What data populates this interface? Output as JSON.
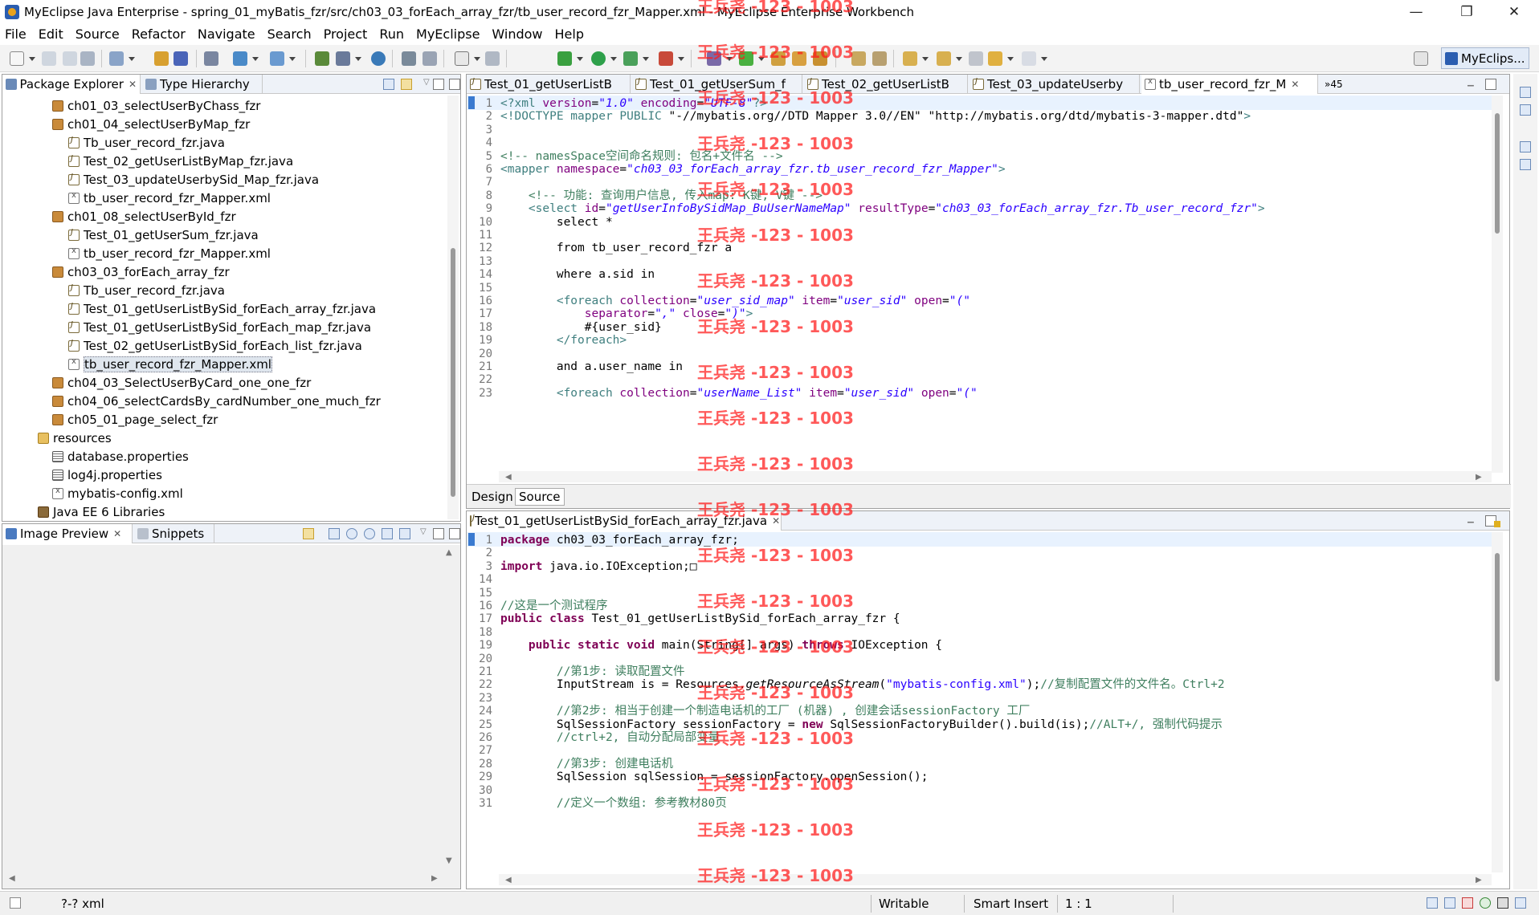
{
  "window": {
    "title": "MyEclipse Java Enterprise - spring_01_myBatis_fzr/src/ch03_03_forEach_array_fzr/tb_user_record_fzr_Mapper.xml - MyEclipse Enterprise Workbench",
    "minimize": "—",
    "maximize": "❐",
    "close": "✕"
  },
  "menu": [
    "File",
    "Edit",
    "Source",
    "Refactor",
    "Navigate",
    "Search",
    "Project",
    "Run",
    "MyEclipse",
    "Window",
    "Help"
  ],
  "perspective": "MyEclips...",
  "package_explorer": {
    "tab1": "Package Explorer",
    "tab2": "Type Hierarchy",
    "items": [
      {
        "label": "ch01_03_selectUserByChass_fzr",
        "kind": "package"
      },
      {
        "label": "ch01_04_selectUserByMap_fzr",
        "kind": "package"
      },
      {
        "label": "Tb_user_record_fzr.java",
        "kind": "java"
      },
      {
        "label": "Test_02_getUserListByMap_fzr.java",
        "kind": "java"
      },
      {
        "label": "Test_03_updateUserbySid_Map_fzr.java",
        "kind": "java"
      },
      {
        "label": "tb_user_record_fzr_Mapper.xml",
        "kind": "xml"
      },
      {
        "label": "ch01_08_selectUserById_fzr",
        "kind": "package"
      },
      {
        "label": "Test_01_getUserSum_fzr.java",
        "kind": "java"
      },
      {
        "label": "tb_user_record_fzr_Mapper.xml",
        "kind": "xml"
      },
      {
        "label": "ch03_03_forEach_array_fzr",
        "kind": "package"
      },
      {
        "label": "Tb_user_record_fzr.java",
        "kind": "java"
      },
      {
        "label": "Test_01_getUserListBySid_forEach_array_fzr.java",
        "kind": "java"
      },
      {
        "label": "Test_01_getUserListBySid_forEach_map_fzr.java",
        "kind": "java"
      },
      {
        "label": "Test_02_getUserListBySid_forEach_list_fzr.java",
        "kind": "java"
      },
      {
        "label": "tb_user_record_fzr_Mapper.xml",
        "kind": "xml",
        "selected": true
      },
      {
        "label": "ch04_03_SelectUserByCard_one_one_fzr",
        "kind": "package"
      },
      {
        "label": "ch04_06_selectCardsBy_cardNumber_one_much_fzr",
        "kind": "package"
      },
      {
        "label": "ch05_01_page_select_fzr",
        "kind": "package"
      },
      {
        "label": "resources",
        "kind": "folder"
      },
      {
        "label": "database.properties",
        "kind": "props"
      },
      {
        "label": "log4j.properties",
        "kind": "props"
      },
      {
        "label": "mybatis-config.xml",
        "kind": "xml"
      },
      {
        "label": "Java EE 6 Libraries",
        "kind": "library"
      }
    ]
  },
  "image_preview": {
    "tab1": "Image Preview",
    "tab2": "Snippets"
  },
  "top_editor": {
    "tabs": [
      "Test_01_getUserListB",
      "Test_01_getUserSum_f",
      "Test_02_getUserListB",
      "Test_03_updateUserby",
      "tb_user_record_fzr_M"
    ],
    "overflow": "»45",
    "mode_tabs": [
      "Design",
      "Source"
    ]
  },
  "bottom_editor": {
    "tab": "Test_01_getUserListBySid_forEach_array_fzr.java"
  },
  "status": {
    "left": "?-? xml",
    "writable": "Writable",
    "insert": "Smart Insert",
    "position": "1 : 1"
  },
  "watermark": "王兵尧 -123 - 1003",
  "colors": {
    "keyword": "#7f0055",
    "comment": "#3f7f5f",
    "string": "#2a00ff",
    "tag": "#3f7f7f",
    "attr": "#7f007f",
    "watermark": "#ff1a1a"
  }
}
